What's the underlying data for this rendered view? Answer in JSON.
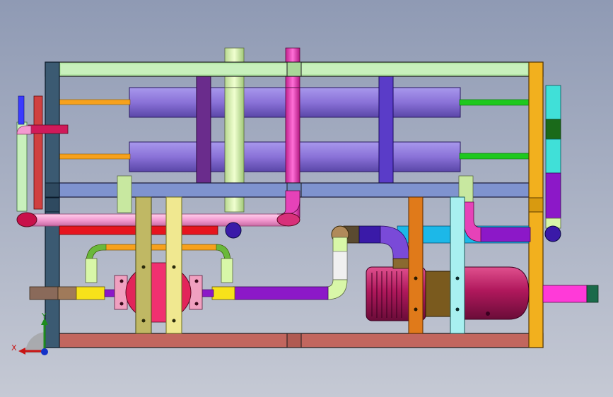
{
  "viewer": {
    "background_top": "#8f9ab4",
    "background_bottom": "#c5c9d4"
  },
  "triad": {
    "x_label": "X",
    "y_label": "Y",
    "x_color": "#c81414",
    "y_color": "#1e8c1e",
    "z_color": "#1432c8"
  },
  "assembly": {
    "frame_top_beam": "#b6e8a8",
    "frame_bottom_beam": "#c2665e",
    "frame_mid_beam": "#7f93cf",
    "left_post": "#3b5a72",
    "right_post": "#f2b01e",
    "heat_exchanger": "#8a72d8",
    "exchanger_saddle_left": "#6a2c8c",
    "exchanger_saddle_right": "#5a3cc8",
    "pump_casing": "#e2245a",
    "motor_body": "#b0185c",
    "motor_coupling": "#7a5a1e",
    "pipe_pink": "#f39ad0",
    "pipe_magenta": "#e642b8",
    "pipe_orange": "#f7a11c",
    "pipe_green": "#1ec81e",
    "pipe_cyan": "#1cb8e8",
    "pipe_teal": "#40e0d8",
    "pipe_purple": "#8c18c8",
    "pipe_yellow": "#f7e21a",
    "pipe_lime": "#d8f7a8",
    "pipe_red": "#e6141e",
    "pipe_darkblue": "#3a1aa8"
  }
}
